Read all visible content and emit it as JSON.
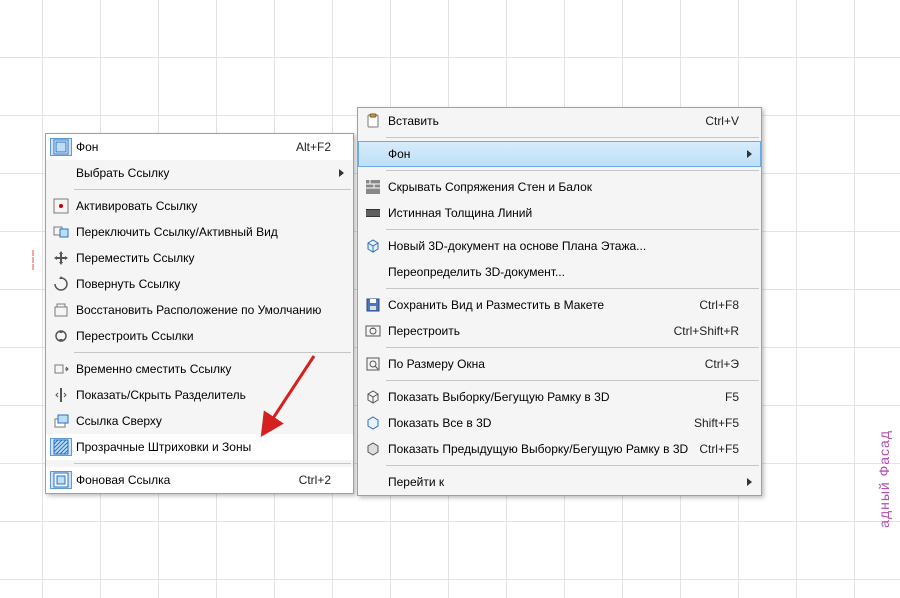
{
  "side_text": "адный Фасад",
  "left_menu": {
    "items": [
      {
        "label": "Фон",
        "shortcut": "Alt+F2",
        "icon": "background-icon",
        "selected": true
      },
      {
        "label": "Выбрать Ссылку",
        "submenu": true
      },
      {
        "sep": true
      },
      {
        "label": "Активировать Ссылку",
        "icon": "activate-icon"
      },
      {
        "label": "Переключить Ссылку/Активный Вид",
        "icon": "switch-icon"
      },
      {
        "label": "Переместить Ссылку",
        "icon": "move-icon"
      },
      {
        "label": "Повернуть Ссылку",
        "icon": "rotate-icon"
      },
      {
        "label": "Восстановить Расположение по Умолчанию",
        "icon": "restore-icon"
      },
      {
        "label": "Перестроить Ссылки",
        "icon": "rebuild-icon"
      },
      {
        "sep": true
      },
      {
        "label": "Временно сместить Ссылку",
        "icon": "tempmove-icon"
      },
      {
        "label": "Показать/Скрыть Разделитель",
        "icon": "splitter-icon"
      },
      {
        "label": "Ссылка Сверху",
        "icon": "ontop-icon"
      },
      {
        "label": "Прозрачные Штриховки и Зоны",
        "icon": "transparent-icon",
        "selected": true
      },
      {
        "sep": true
      },
      {
        "label": "Фоновая Ссылка",
        "shortcut": "Ctrl+2",
        "icon": "bglink-icon",
        "selected": true
      }
    ]
  },
  "right_menu": {
    "items": [
      {
        "label": "Вставить",
        "shortcut": "Ctrl+V",
        "icon": "paste-icon"
      },
      {
        "sep": true
      },
      {
        "label": "Фон",
        "submenu": true,
        "highlight": true
      },
      {
        "sep": true
      },
      {
        "label": "Скрывать Сопряжения Стен и Балок",
        "icon": "walls-icon"
      },
      {
        "label": "Истинная Толщина Линий",
        "icon": "lines-icon"
      },
      {
        "sep": true
      },
      {
        "label": "Новый 3D-документ на основе Плана Этажа...",
        "icon": "new3d-icon"
      },
      {
        "label": "Переопределить 3D-документ..."
      },
      {
        "sep": true
      },
      {
        "label": "Сохранить Вид и Разместить в Макете",
        "shortcut": "Ctrl+F8",
        "icon": "save-icon"
      },
      {
        "label": "Перестроить",
        "shortcut": "Ctrl+Shift+R",
        "icon": "rebuild2-icon"
      },
      {
        "sep": true
      },
      {
        "label": "По Размеру Окна",
        "shortcut": "Ctrl+Э",
        "icon": "fit-icon"
      },
      {
        "sep": true
      },
      {
        "label": "Показать Выборку/Бегущую Рамку в 3D",
        "shortcut": "F5",
        "icon": "show3d-icon"
      },
      {
        "label": "Показать Все в 3D",
        "shortcut": "Shift+F5",
        "icon": "showall3d-icon"
      },
      {
        "label": "Показать Предыдущую Выборку/Бегущую Рамку в 3D",
        "shortcut": "Ctrl+F5",
        "icon": "showprev3d-icon"
      },
      {
        "sep": true
      },
      {
        "label": "Перейти к",
        "submenu": true
      }
    ]
  }
}
